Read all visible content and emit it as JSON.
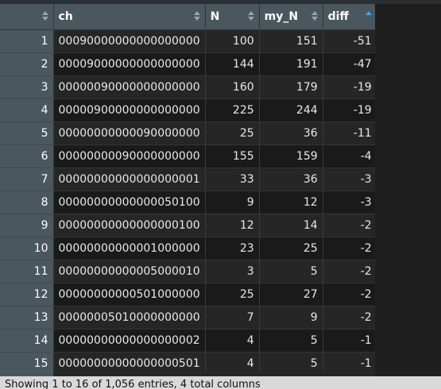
{
  "table": {
    "columns": [
      {
        "label": "",
        "sort": "none"
      },
      {
        "label": "ch",
        "sort": "none"
      },
      {
        "label": "N",
        "sort": "none"
      },
      {
        "label": "my_N",
        "sort": "none"
      },
      {
        "label": "diff",
        "sort": "ascending"
      }
    ],
    "rows": [
      {
        "row": "1",
        "ch": "00090000000000000000",
        "N": "100",
        "my_N": "151",
        "diff": "-51"
      },
      {
        "row": "2",
        "ch": "00009000000000000000",
        "N": "144",
        "my_N": "191",
        "diff": "-47"
      },
      {
        "row": "3",
        "ch": "00000090000000000000",
        "N": "160",
        "my_N": "179",
        "diff": "-19"
      },
      {
        "row": "4",
        "ch": "00000900000000000000",
        "N": "225",
        "my_N": "244",
        "diff": "-19"
      },
      {
        "row": "5",
        "ch": "00000000000090000000",
        "N": "25",
        "my_N": "36",
        "diff": "-11"
      },
      {
        "row": "6",
        "ch": "00000000090000000000",
        "N": "155",
        "my_N": "159",
        "diff": "-4"
      },
      {
        "row": "7",
        "ch": "00000000000000000001",
        "N": "33",
        "my_N": "36",
        "diff": "-3"
      },
      {
        "row": "8",
        "ch": "00000000000000050100",
        "N": "9",
        "my_N": "12",
        "diff": "-3"
      },
      {
        "row": "9",
        "ch": "00000000000000000100",
        "N": "12",
        "my_N": "14",
        "diff": "-2"
      },
      {
        "row": "10",
        "ch": "00000000000001000000",
        "N": "23",
        "my_N": "25",
        "diff": "-2"
      },
      {
        "row": "11",
        "ch": "00000000000005000010",
        "N": "3",
        "my_N": "5",
        "diff": "-2"
      },
      {
        "row": "12",
        "ch": "00000000000501000000",
        "N": "25",
        "my_N": "27",
        "diff": "-2"
      },
      {
        "row": "13",
        "ch": "00000005010000000000",
        "N": "7",
        "my_N": "9",
        "diff": "-2"
      },
      {
        "row": "14",
        "ch": "00000000000000000002",
        "N": "4",
        "my_N": "5",
        "diff": "-1"
      },
      {
        "row": "15",
        "ch": "00000000000000000501",
        "N": "4",
        "my_N": "5",
        "diff": "-1"
      }
    ]
  },
  "footer": {
    "status": "Showing 1 to 16 of 1,056 entries, 4 total columns"
  },
  "colors": {
    "header_bg": "#4b575f",
    "sort_active": "#4aa3e8",
    "row_odd": "#262626",
    "row_even": "#1a1a1a"
  }
}
